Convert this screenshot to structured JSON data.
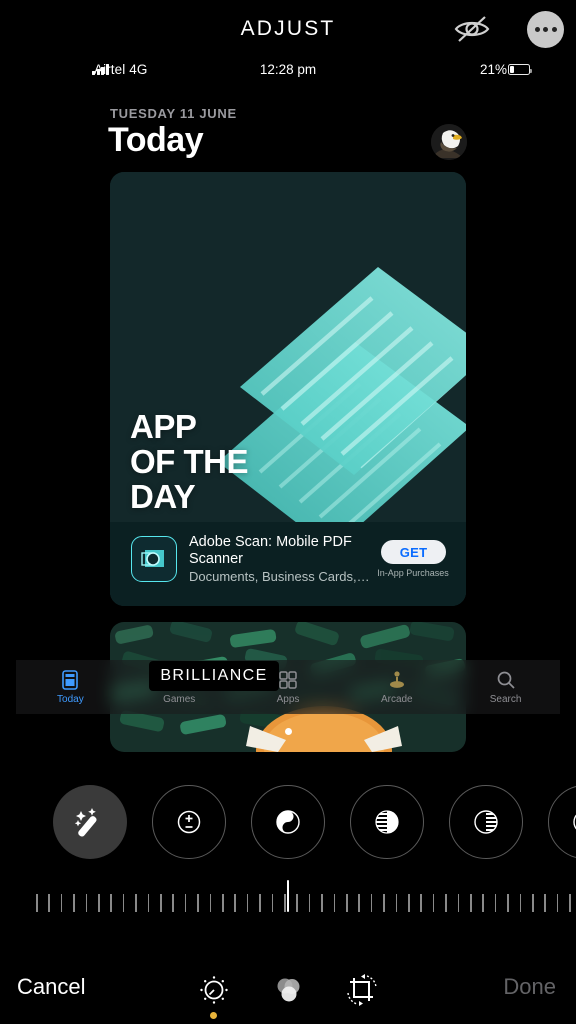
{
  "editor": {
    "title": "ADJUST",
    "hide_icon": "eye-slash-icon",
    "more_icon": "ellipsis-icon",
    "cancel_label": "Cancel",
    "done_label": "Done",
    "active_adjustment": "BRILLIANCE",
    "slider_value_position_pct": 50,
    "accent_color": "#e8b33a",
    "tools": [
      {
        "name": "adjust-tool",
        "icon": "dial-icon",
        "selected": true
      },
      {
        "name": "filters-tool",
        "icon": "filters-icon",
        "selected": false
      },
      {
        "name": "crop-tool",
        "icon": "crop-rotate-icon",
        "selected": false
      }
    ],
    "adjustments": [
      {
        "label": "Auto",
        "icon": "magic-wand-icon",
        "selected": true,
        "style": "fill"
      },
      {
        "label": "Exposure",
        "icon": "exposure-icon",
        "selected": false,
        "style": "ring"
      },
      {
        "label": "Brilliance",
        "icon": "brilliance-icon",
        "selected": false,
        "style": "ring"
      },
      {
        "label": "Highlights",
        "icon": "highlights-icon",
        "selected": false,
        "style": "ring"
      },
      {
        "label": "Shadows",
        "icon": "shadows-icon",
        "selected": false,
        "style": "ring"
      },
      {
        "label": "Contrast",
        "icon": "contrast-icon",
        "selected": false,
        "style": "ring"
      }
    ]
  },
  "photo": {
    "status_bar": {
      "carrier": "Airtel 4G",
      "signal_icon": "cellular-bars-icon",
      "time": "12:28 pm",
      "battery_percent": "21%",
      "battery_icon": "battery-icon"
    },
    "header": {
      "date": "TUESDAY 11 JUNE",
      "title": "Today",
      "avatar": "profile-avatar"
    },
    "app_of_the_day": {
      "headline": "APP\nOF THE\nDAY",
      "app_name": "Adobe Scan: Mobile PDF Scanner",
      "app_subtitle": "Documents, Business Cards,…",
      "get_label": "GET",
      "iap_note": "In-App Purchases",
      "app_icon": "adobe-scan-icon",
      "card_color": "#13282a",
      "art_color": "#4fd4ce"
    },
    "tab_bar": {
      "selected_color": "#3f9bff",
      "items": [
        {
          "label": "Today",
          "icon": "today-icon",
          "selected": true
        },
        {
          "label": "Games",
          "icon": "rocket-icon",
          "selected": false
        },
        {
          "label": "Apps",
          "icon": "apps-icon",
          "selected": false
        },
        {
          "label": "Arcade",
          "icon": "arcade-icon",
          "selected": false
        },
        {
          "label": "Search",
          "icon": "search-icon",
          "selected": false
        }
      ]
    }
  }
}
